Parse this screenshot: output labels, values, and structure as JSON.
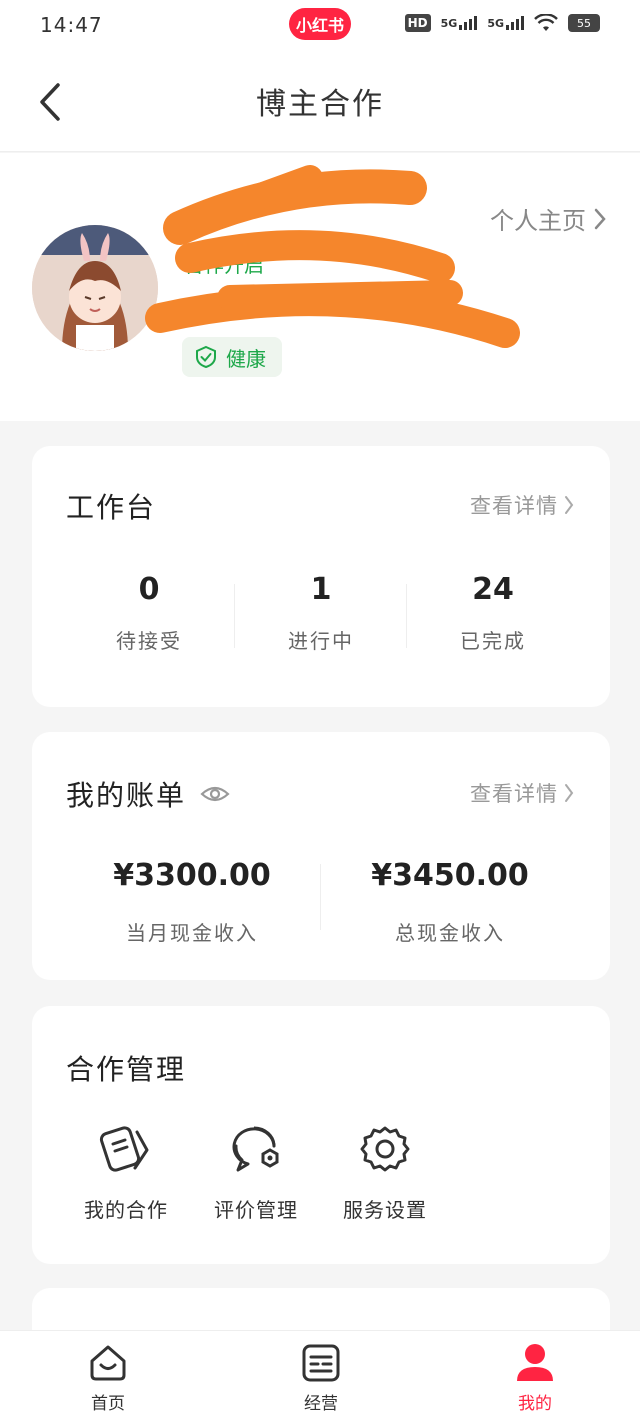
{
  "status_bar": {
    "time": "14:47",
    "app_badge": "小红书",
    "hd": "HD",
    "signal1": "5G",
    "signal2": "5G",
    "battery": "55"
  },
  "header": {
    "title": "博主合作"
  },
  "profile": {
    "home_link": "个人主页",
    "status_text": "合作开启",
    "health_label": "健康"
  },
  "workbench": {
    "title": "工作台",
    "detail_link": "查看详情",
    "stats": [
      {
        "value": "0",
        "label": "待接受"
      },
      {
        "value": "1",
        "label": "进行中"
      },
      {
        "value": "24",
        "label": "已完成"
      }
    ]
  },
  "bill": {
    "title": "我的账单",
    "detail_link": "查看详情",
    "items": [
      {
        "value": "¥3300.00",
        "label": "当月现金收入"
      },
      {
        "value": "¥3450.00",
        "label": "总现金收入"
      }
    ]
  },
  "cooperation": {
    "title": "合作管理",
    "items": [
      {
        "label": "我的合作",
        "icon": "document-icon"
      },
      {
        "label": "评价管理",
        "icon": "review-bubble-icon"
      },
      {
        "label": "服务设置",
        "icon": "gear-icon"
      }
    ]
  },
  "bottom_nav": {
    "items": [
      {
        "label": "首页",
        "icon": "home-icon"
      },
      {
        "label": "经营",
        "icon": "manage-icon"
      },
      {
        "label": "我的",
        "icon": "profile-icon"
      }
    ],
    "active_index": 2
  },
  "colors": {
    "brand": "#ff2442",
    "health_green": "#1ea84a",
    "scribble": "#f5862c"
  }
}
